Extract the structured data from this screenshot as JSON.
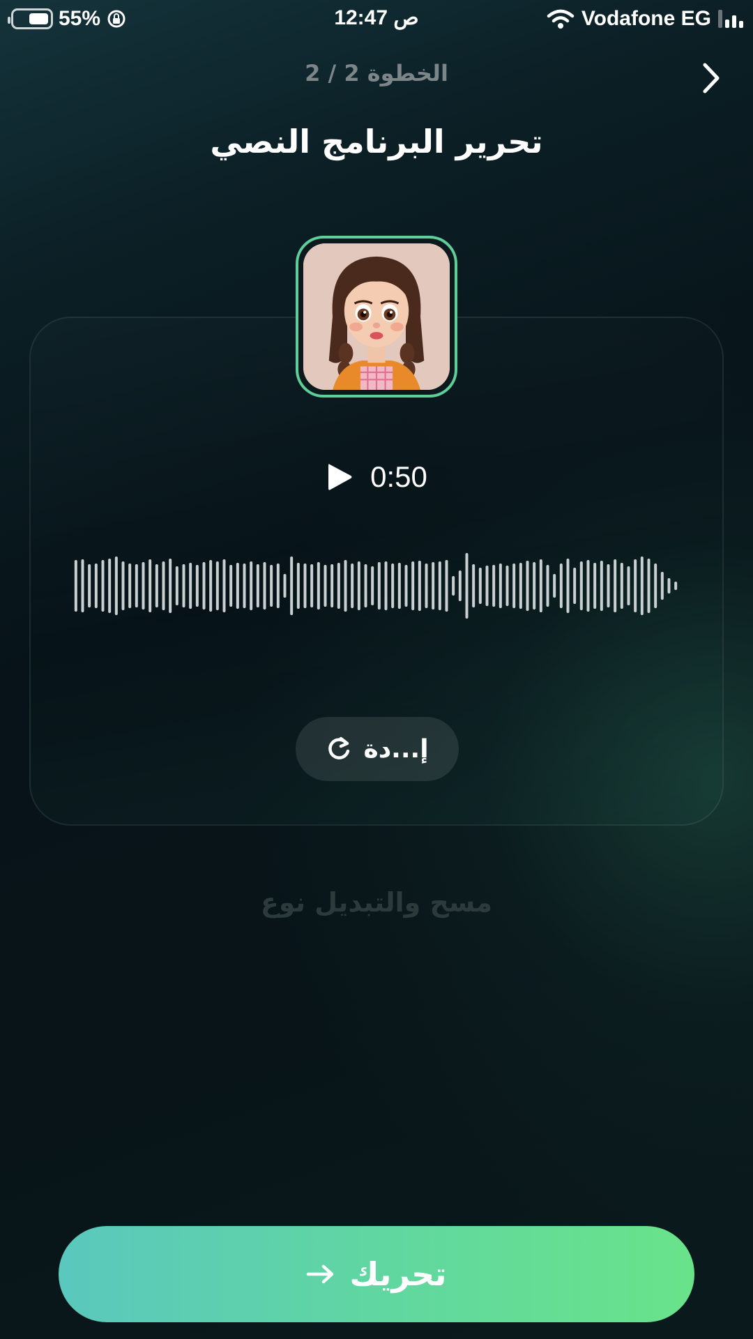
{
  "status_bar": {
    "battery_percent": "55%",
    "time": "12:47 ص",
    "carrier": "Vodafone EG"
  },
  "header": {
    "step": "الخطوة 2 / 2",
    "title": "تحرير البرنامج النصي",
    "back_icon": "chevron-right-icon"
  },
  "player": {
    "duration": "0:50",
    "play_icon": "play-icon"
  },
  "regenerate": {
    "label": "إ...دة",
    "icon": "refresh-icon"
  },
  "clear_link": "مسح والتبديل نوع",
  "cta": {
    "label": "تحريك",
    "icon": "arrow-right-icon"
  },
  "colors": {
    "accent_border": "#5fcf9a",
    "cta_start": "#5ac8bd",
    "cta_end": "#69e38a",
    "muted_text": "#7c8588"
  }
}
